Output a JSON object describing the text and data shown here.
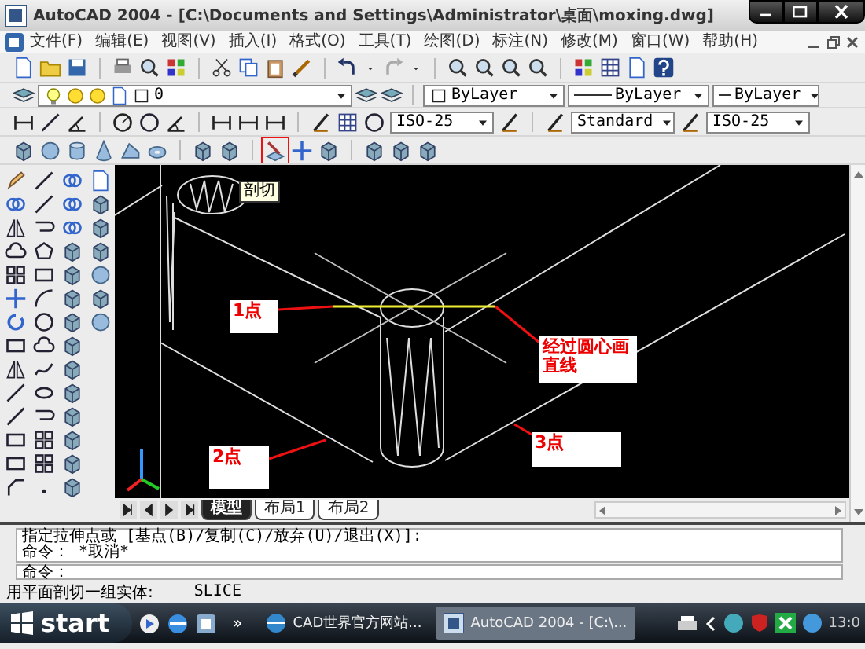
{
  "window": {
    "title": "AutoCAD 2004 - [C:\\Documents and Settings\\Administrator\\桌面\\moxing.dwg]"
  },
  "menu": [
    "文件(F)",
    "编辑(E)",
    "视图(V)",
    "插入(I)",
    "格式(O)",
    "工具(T)",
    "绘图(D)",
    "标注(N)",
    "修改(M)",
    "窗口(W)",
    "帮助(H)"
  ],
  "layer_toolbar": {
    "layer": "0",
    "color_setting": "ByLayer",
    "linetype": "ByLayer",
    "lineweight": "ByLayer"
  },
  "styles_toolbar": {
    "dimension_style": "ISO-25",
    "text_style": "Standard",
    "combo_3": "ISO-25"
  },
  "tooltip": "剖切",
  "drawing": {
    "callouts": [
      "1点",
      "经过圆心画直线",
      "2点",
      "3点"
    ]
  },
  "layout_tabs": [
    {
      "label": "模型",
      "selected": true
    },
    {
      "label": "布局1",
      "selected": false
    },
    {
      "label": "布局2",
      "selected": false
    }
  ],
  "command_history": [
    "指定拉伸点或 [基点(B)/复制(C)/放弃(U)/退出(X)]:",
    "命令： *取消*"
  ],
  "command_prompt": "命令：",
  "status_bar": {
    "prompt": "用平面剖切一组实体:",
    "command": "SLICE"
  },
  "taskbar": {
    "start": "start",
    "more": "»",
    "tasks": [
      {
        "label": "CAD世界官方网站...",
        "selected": false
      },
      {
        "label": "AutoCAD 2004 - [C:\\...",
        "selected": true
      }
    ],
    "clock": "13:0"
  }
}
